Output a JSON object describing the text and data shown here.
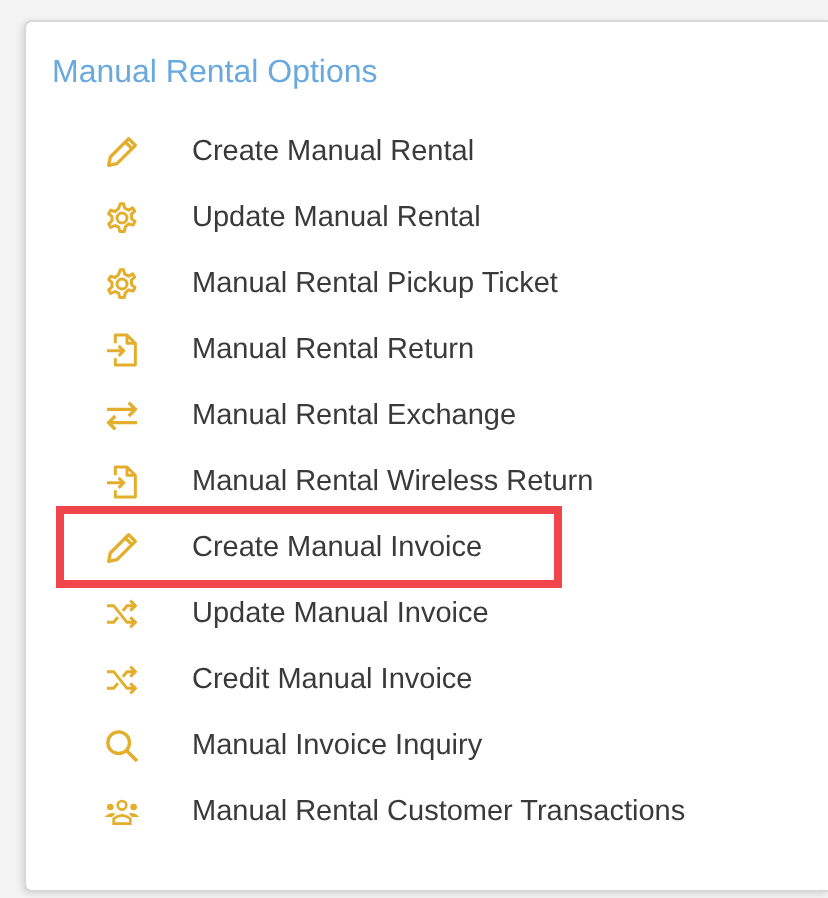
{
  "panel": {
    "title": "Manual Rental Options",
    "items": [
      {
        "label": "Create Manual Rental",
        "kind": "pencil",
        "highlighted": false
      },
      {
        "label": "Update Manual Rental",
        "kind": "gear",
        "highlighted": false
      },
      {
        "label": "Manual Rental Pickup Ticket",
        "kind": "gear",
        "highlighted": false
      },
      {
        "label": "Manual Rental Return",
        "kind": "import",
        "highlighted": false
      },
      {
        "label": "Manual Rental Exchange",
        "kind": "exchange",
        "highlighted": false
      },
      {
        "label": "Manual Rental Wireless Return",
        "kind": "import",
        "highlighted": false
      },
      {
        "label": "Create Manual Invoice",
        "kind": "pencil",
        "highlighted": true
      },
      {
        "label": "Update Manual Invoice",
        "kind": "shuffle",
        "highlighted": false
      },
      {
        "label": "Credit Manual Invoice",
        "kind": "shuffle",
        "highlighted": false
      },
      {
        "label": "Manual Invoice Inquiry",
        "kind": "search",
        "highlighted": false
      },
      {
        "label": "Manual Rental Customer Transactions",
        "kind": "users",
        "highlighted": false
      }
    ]
  }
}
